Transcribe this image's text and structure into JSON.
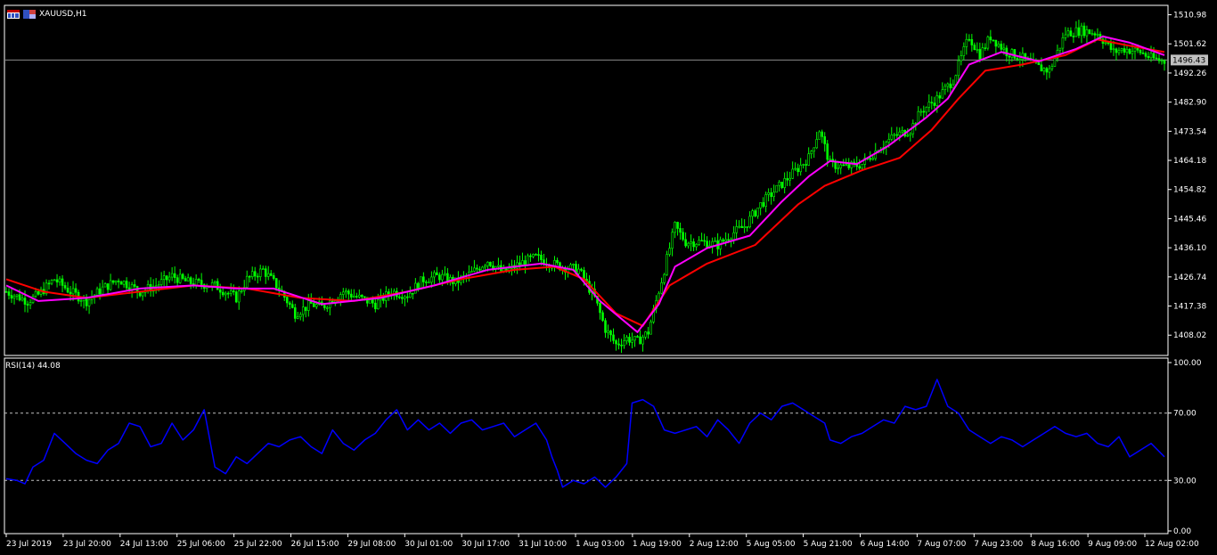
{
  "header": {
    "symbol_label": "XAUUSD,H1",
    "rsi_label": "RSI(14) 44.08"
  },
  "colors": {
    "background": "#000000",
    "frame": "#ffffff",
    "bull_candle": "#00ff00",
    "bear_candle": "#00ff00",
    "ma_fast": "#ff00ff",
    "ma_slow": "#ff0000",
    "rsi_line": "#0000ff",
    "level_line": "#c0c0c0",
    "price_tag_bg": "#c0c0c0"
  },
  "chart_data": [
    {
      "type": "candlestick",
      "title": "XAUUSD,H1",
      "ylim": [
        1401.5,
        1514.0
      ],
      "yticks": [
        "1510.98",
        "1501.62",
        "1492.26",
        "1482.90",
        "1473.54",
        "1464.18",
        "1454.82",
        "1445.46",
        "1436.10",
        "1426.74",
        "1417.38",
        "1408.02"
      ],
      "current_price": "1496.43",
      "xticks": [
        "23 Jul 2019",
        "23 Jul 20:00",
        "24 Jul 13:00",
        "25 Jul 06:00",
        "25 Jul 22:00",
        "26 Jul 15:00",
        "29 Jul 08:00",
        "30 Jul 01:00",
        "30 Jul 17:00",
        "31 Jul 10:00",
        "1 Aug 03:00",
        "1 Aug 19:00",
        "2 Aug 12:00",
        "5 Aug 05:00",
        "5 Aug 21:00",
        "6 Aug 14:00",
        "7 Aug 07:00",
        "7 Aug 23:00",
        "8 Aug 16:00",
        "9 Aug 09:00",
        "12 Aug 02:00"
      ],
      "close_path": [
        [
          0,
          1422
        ],
        [
          8,
          1419
        ],
        [
          12,
          1421
        ],
        [
          18,
          1426
        ],
        [
          24,
          1422
        ],
        [
          30,
          1419
        ],
        [
          36,
          1423
        ],
        [
          42,
          1426
        ],
        [
          50,
          1422
        ],
        [
          56,
          1424
        ],
        [
          62,
          1427
        ],
        [
          68,
          1425
        ],
        [
          78,
          1424
        ],
        [
          86,
          1420
        ],
        [
          90,
          1426
        ],
        [
          96,
          1429
        ],
        [
          102,
          1423
        ],
        [
          108,
          1415
        ],
        [
          114,
          1418
        ],
        [
          118,
          1417
        ],
        [
          126,
          1422
        ],
        [
          132,
          1420
        ],
        [
          138,
          1418
        ],
        [
          144,
          1422
        ],
        [
          150,
          1421
        ],
        [
          156,
          1426
        ],
        [
          162,
          1427
        ],
        [
          168,
          1425
        ],
        [
          174,
          1428
        ],
        [
          180,
          1432
        ],
        [
          186,
          1428
        ],
        [
          192,
          1431
        ],
        [
          198,
          1433
        ],
        [
          204,
          1431
        ],
        [
          208,
          1430
        ],
        [
          214,
          1429
        ],
        [
          220,
          1420
        ],
        [
          224,
          1410
        ],
        [
          228,
          1405
        ],
        [
          232,
          1407
        ],
        [
          236,
          1406
        ],
        [
          240,
          1409
        ],
        [
          246,
          1429
        ],
        [
          250,
          1443
        ],
        [
          254,
          1438
        ],
        [
          260,
          1438
        ],
        [
          266,
          1437
        ],
        [
          272,
          1441
        ],
        [
          276,
          1443
        ],
        [
          282,
          1450
        ],
        [
          288,
          1455
        ],
        [
          294,
          1460
        ],
        [
          300,
          1465
        ],
        [
          304,
          1474
        ],
        [
          308,
          1463
        ],
        [
          314,
          1462
        ],
        [
          320,
          1463
        ],
        [
          326,
          1468
        ],
        [
          332,
          1472
        ],
        [
          338,
          1474
        ],
        [
          342,
          1480
        ],
        [
          348,
          1484
        ],
        [
          354,
          1490
        ],
        [
          360,
          1504
        ],
        [
          364,
          1498
        ],
        [
          368,
          1504
        ],
        [
          374,
          1499
        ],
        [
          380,
          1497
        ],
        [
          386,
          1494
        ],
        [
          390,
          1493
        ],
        [
          396,
          1505
        ],
        [
          402,
          1506
        ],
        [
          408,
          1505
        ],
        [
          414,
          1499
        ],
        [
          418,
          1500
        ],
        [
          424,
          1499
        ],
        [
          428,
          1497
        ],
        [
          433,
          1496
        ]
      ],
      "ma_fast": [
        [
          0,
          1424
        ],
        [
          12,
          1419
        ],
        [
          30,
          1420
        ],
        [
          50,
          1423
        ],
        [
          70,
          1424
        ],
        [
          86,
          1423
        ],
        [
          100,
          1423
        ],
        [
          118,
          1418
        ],
        [
          140,
          1420
        ],
        [
          160,
          1424
        ],
        [
          180,
          1429
        ],
        [
          200,
          1431
        ],
        [
          212,
          1429
        ],
        [
          222,
          1419
        ],
        [
          236,
          1409
        ],
        [
          244,
          1418
        ],
        [
          250,
          1430
        ],
        [
          262,
          1436
        ],
        [
          278,
          1440
        ],
        [
          290,
          1451
        ],
        [
          300,
          1459
        ],
        [
          308,
          1464
        ],
        [
          318,
          1463
        ],
        [
          330,
          1469
        ],
        [
          344,
          1478
        ],
        [
          352,
          1484
        ],
        [
          360,
          1495
        ],
        [
          372,
          1499
        ],
        [
          386,
          1496
        ],
        [
          400,
          1500
        ],
        [
          410,
          1504
        ],
        [
          420,
          1502
        ],
        [
          433,
          1498
        ]
      ],
      "ma_slow": [
        [
          0,
          1426
        ],
        [
          14,
          1422
        ],
        [
          30,
          1420
        ],
        [
          50,
          1422
        ],
        [
          70,
          1424
        ],
        [
          90,
          1423
        ],
        [
          110,
          1420
        ],
        [
          130,
          1419
        ],
        [
          150,
          1422
        ],
        [
          170,
          1426
        ],
        [
          190,
          1429
        ],
        [
          205,
          1430
        ],
        [
          216,
          1426
        ],
        [
          228,
          1415
        ],
        [
          238,
          1411
        ],
        [
          248,
          1424
        ],
        [
          262,
          1431
        ],
        [
          280,
          1437
        ],
        [
          296,
          1450
        ],
        [
          306,
          1456
        ],
        [
          320,
          1461
        ],
        [
          334,
          1465
        ],
        [
          346,
          1474
        ],
        [
          356,
          1484
        ],
        [
          366,
          1493
        ],
        [
          380,
          1495
        ],
        [
          396,
          1498
        ],
        [
          408,
          1503
        ],
        [
          420,
          1501
        ],
        [
          433,
          1499
        ]
      ]
    },
    {
      "type": "line",
      "title": "RSI(14) 44.08",
      "ylim": [
        0,
        100
      ],
      "yticks": [
        "100.00",
        "70.00",
        "30.00",
        "0.00"
      ],
      "levels": [
        70,
        30
      ],
      "series": [
        {
          "values": [
            [
              0,
              31
            ],
            [
              4,
              30
            ],
            [
              7,
              28
            ],
            [
              10,
              38
            ],
            [
              14,
              42
            ],
            [
              18,
              58
            ],
            [
              22,
              52
            ],
            [
              26,
              46
            ],
            [
              30,
              42
            ],
            [
              34,
              40
            ],
            [
              38,
              48
            ],
            [
              42,
              52
            ],
            [
              46,
              64
            ],
            [
              50,
              62
            ],
            [
              54,
              50
            ],
            [
              58,
              52
            ],
            [
              62,
              64
            ],
            [
              66,
              54
            ],
            [
              70,
              60
            ],
            [
              74,
              72
            ],
            [
              78,
              38
            ],
            [
              82,
              34
            ],
            [
              86,
              44
            ],
            [
              90,
              40
            ],
            [
              94,
              46
            ],
            [
              98,
              52
            ],
            [
              102,
              50
            ],
            [
              106,
              54
            ],
            [
              110,
              56
            ],
            [
              114,
              50
            ],
            [
              118,
              46
            ],
            [
              122,
              60
            ],
            [
              126,
              52
            ],
            [
              130,
              48
            ],
            [
              134,
              54
            ],
            [
              138,
              58
            ],
            [
              142,
              66
            ],
            [
              146,
              72
            ],
            [
              150,
              60
            ],
            [
              154,
              66
            ],
            [
              158,
              60
            ],
            [
              162,
              64
            ],
            [
              166,
              58
            ],
            [
              170,
              64
            ],
            [
              174,
              66
            ],
            [
              178,
              60
            ],
            [
              182,
              62
            ],
            [
              186,
              64
            ],
            [
              190,
              56
            ],
            [
              194,
              60
            ],
            [
              198,
              64
            ],
            [
              202,
              54
            ],
            [
              204,
              44
            ],
            [
              206,
              36
            ],
            [
              208,
              26
            ],
            [
              212,
              30
            ],
            [
              216,
              28
            ],
            [
              220,
              32
            ],
            [
              224,
              26
            ],
            [
              228,
              32
            ],
            [
              232,
              40
            ],
            [
              234,
              76
            ],
            [
              238,
              78
            ],
            [
              242,
              74
            ],
            [
              246,
              60
            ],
            [
              250,
              58
            ],
            [
              254,
              60
            ],
            [
              258,
              62
            ],
            [
              262,
              56
            ],
            [
              266,
              66
            ],
            [
              270,
              60
            ],
            [
              274,
              52
            ],
            [
              278,
              64
            ],
            [
              282,
              70
            ],
            [
              286,
              66
            ],
            [
              290,
              74
            ],
            [
              294,
              76
            ],
            [
              298,
              72
            ],
            [
              302,
              68
            ],
            [
              306,
              64
            ],
            [
              308,
              54
            ],
            [
              312,
              52
            ],
            [
              316,
              56
            ],
            [
              320,
              58
            ],
            [
              324,
              62
            ],
            [
              328,
              66
            ],
            [
              332,
              64
            ],
            [
              336,
              74
            ],
            [
              340,
              72
            ],
            [
              344,
              74
            ],
            [
              348,
              90
            ],
            [
              352,
              74
            ],
            [
              356,
              70
            ],
            [
              360,
              60
            ],
            [
              364,
              56
            ],
            [
              368,
              52
            ],
            [
              372,
              56
            ],
            [
              376,
              54
            ],
            [
              380,
              50
            ],
            [
              384,
              54
            ],
            [
              388,
              58
            ],
            [
              392,
              62
            ],
            [
              396,
              58
            ],
            [
              400,
              56
            ],
            [
              404,
              58
            ],
            [
              408,
              52
            ],
            [
              412,
              50
            ],
            [
              416,
              56
            ],
            [
              420,
              44
            ],
            [
              424,
              48
            ],
            [
              428,
              52
            ],
            [
              433,
              44
            ]
          ]
        }
      ]
    }
  ]
}
